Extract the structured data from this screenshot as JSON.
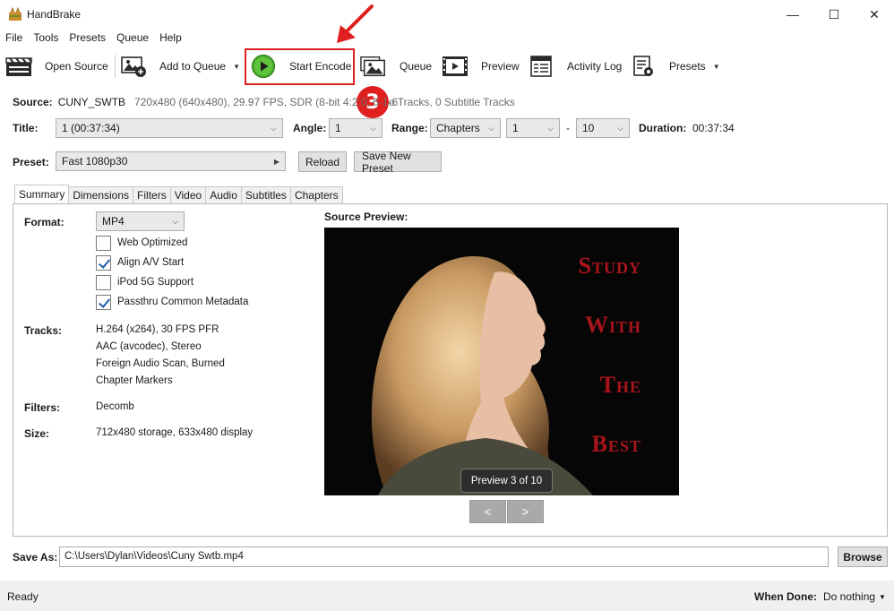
{
  "window": {
    "title": "HandBrake",
    "controls": {
      "minimize": "—",
      "maximize": "☐",
      "close": "✕"
    }
  },
  "menu": [
    "File",
    "Tools",
    "Presets",
    "Queue",
    "Help"
  ],
  "toolbar": {
    "open_source": "Open Source",
    "add_to_queue": "Add to Queue",
    "start_encode": "Start Encode",
    "queue": "Queue",
    "preview": "Preview",
    "activity_log": "Activity Log",
    "presets": "Presets"
  },
  "annotation": {
    "step": "3",
    "color": "#e02020"
  },
  "source": {
    "label": "Source:",
    "name": "CUNY_SWTB",
    "details": "720x480 (640x480), 29.97 FPS, SDR (8-bit 4:2:0, 6-1-6",
    "details_tail": "o Tracks, 0 Subtitle Tracks"
  },
  "title_row": {
    "title_label": "Title:",
    "title_value": "1  (00:37:34)",
    "angle_label": "Angle:",
    "angle_value": "1",
    "range_label": "Range:",
    "range_type": "Chapters",
    "range_start": "1",
    "range_dash": "-",
    "range_end": "10",
    "duration_label": "Duration:",
    "duration_value": "00:37:34"
  },
  "preset_row": {
    "label": "Preset:",
    "value": "Fast 1080p30",
    "reload": "Reload",
    "save_new": "Save New Preset"
  },
  "tabs": [
    "Summary",
    "Dimensions",
    "Filters",
    "Video",
    "Audio",
    "Subtitles",
    "Chapters"
  ],
  "summary": {
    "format_label": "Format:",
    "format_value": "MP4",
    "options": [
      {
        "label": "Web Optimized",
        "checked": false
      },
      {
        "label": "Align A/V Start",
        "checked": true
      },
      {
        "label": "iPod 5G Support",
        "checked": false
      },
      {
        "label": "Passthru Common Metadata",
        "checked": true
      }
    ],
    "tracks_label": "Tracks:",
    "tracks": [
      "H.264 (x264), 30 FPS PFR",
      "AAC (avcodec), Stereo",
      "Foreign Audio Scan, Burned",
      "Chapter Markers"
    ],
    "filters_label": "Filters:",
    "filters_value": "Decomb",
    "size_label": "Size:",
    "size_value": "712x480 storage, 633x480 display"
  },
  "source_preview": {
    "label": "Source Preview:",
    "overlay_lines": [
      "Study",
      "With",
      "The",
      "Best"
    ],
    "counter": "Preview 3 of 10",
    "prev": "<",
    "next": ">"
  },
  "save_as": {
    "label": "Save As:",
    "path": "C:\\Users\\Dylan\\Videos\\Cuny Swtb.mp4",
    "browse": "Browse"
  },
  "status": {
    "text": "Ready",
    "when_done_label": "When Done:",
    "when_done_value": "Do nothing"
  }
}
